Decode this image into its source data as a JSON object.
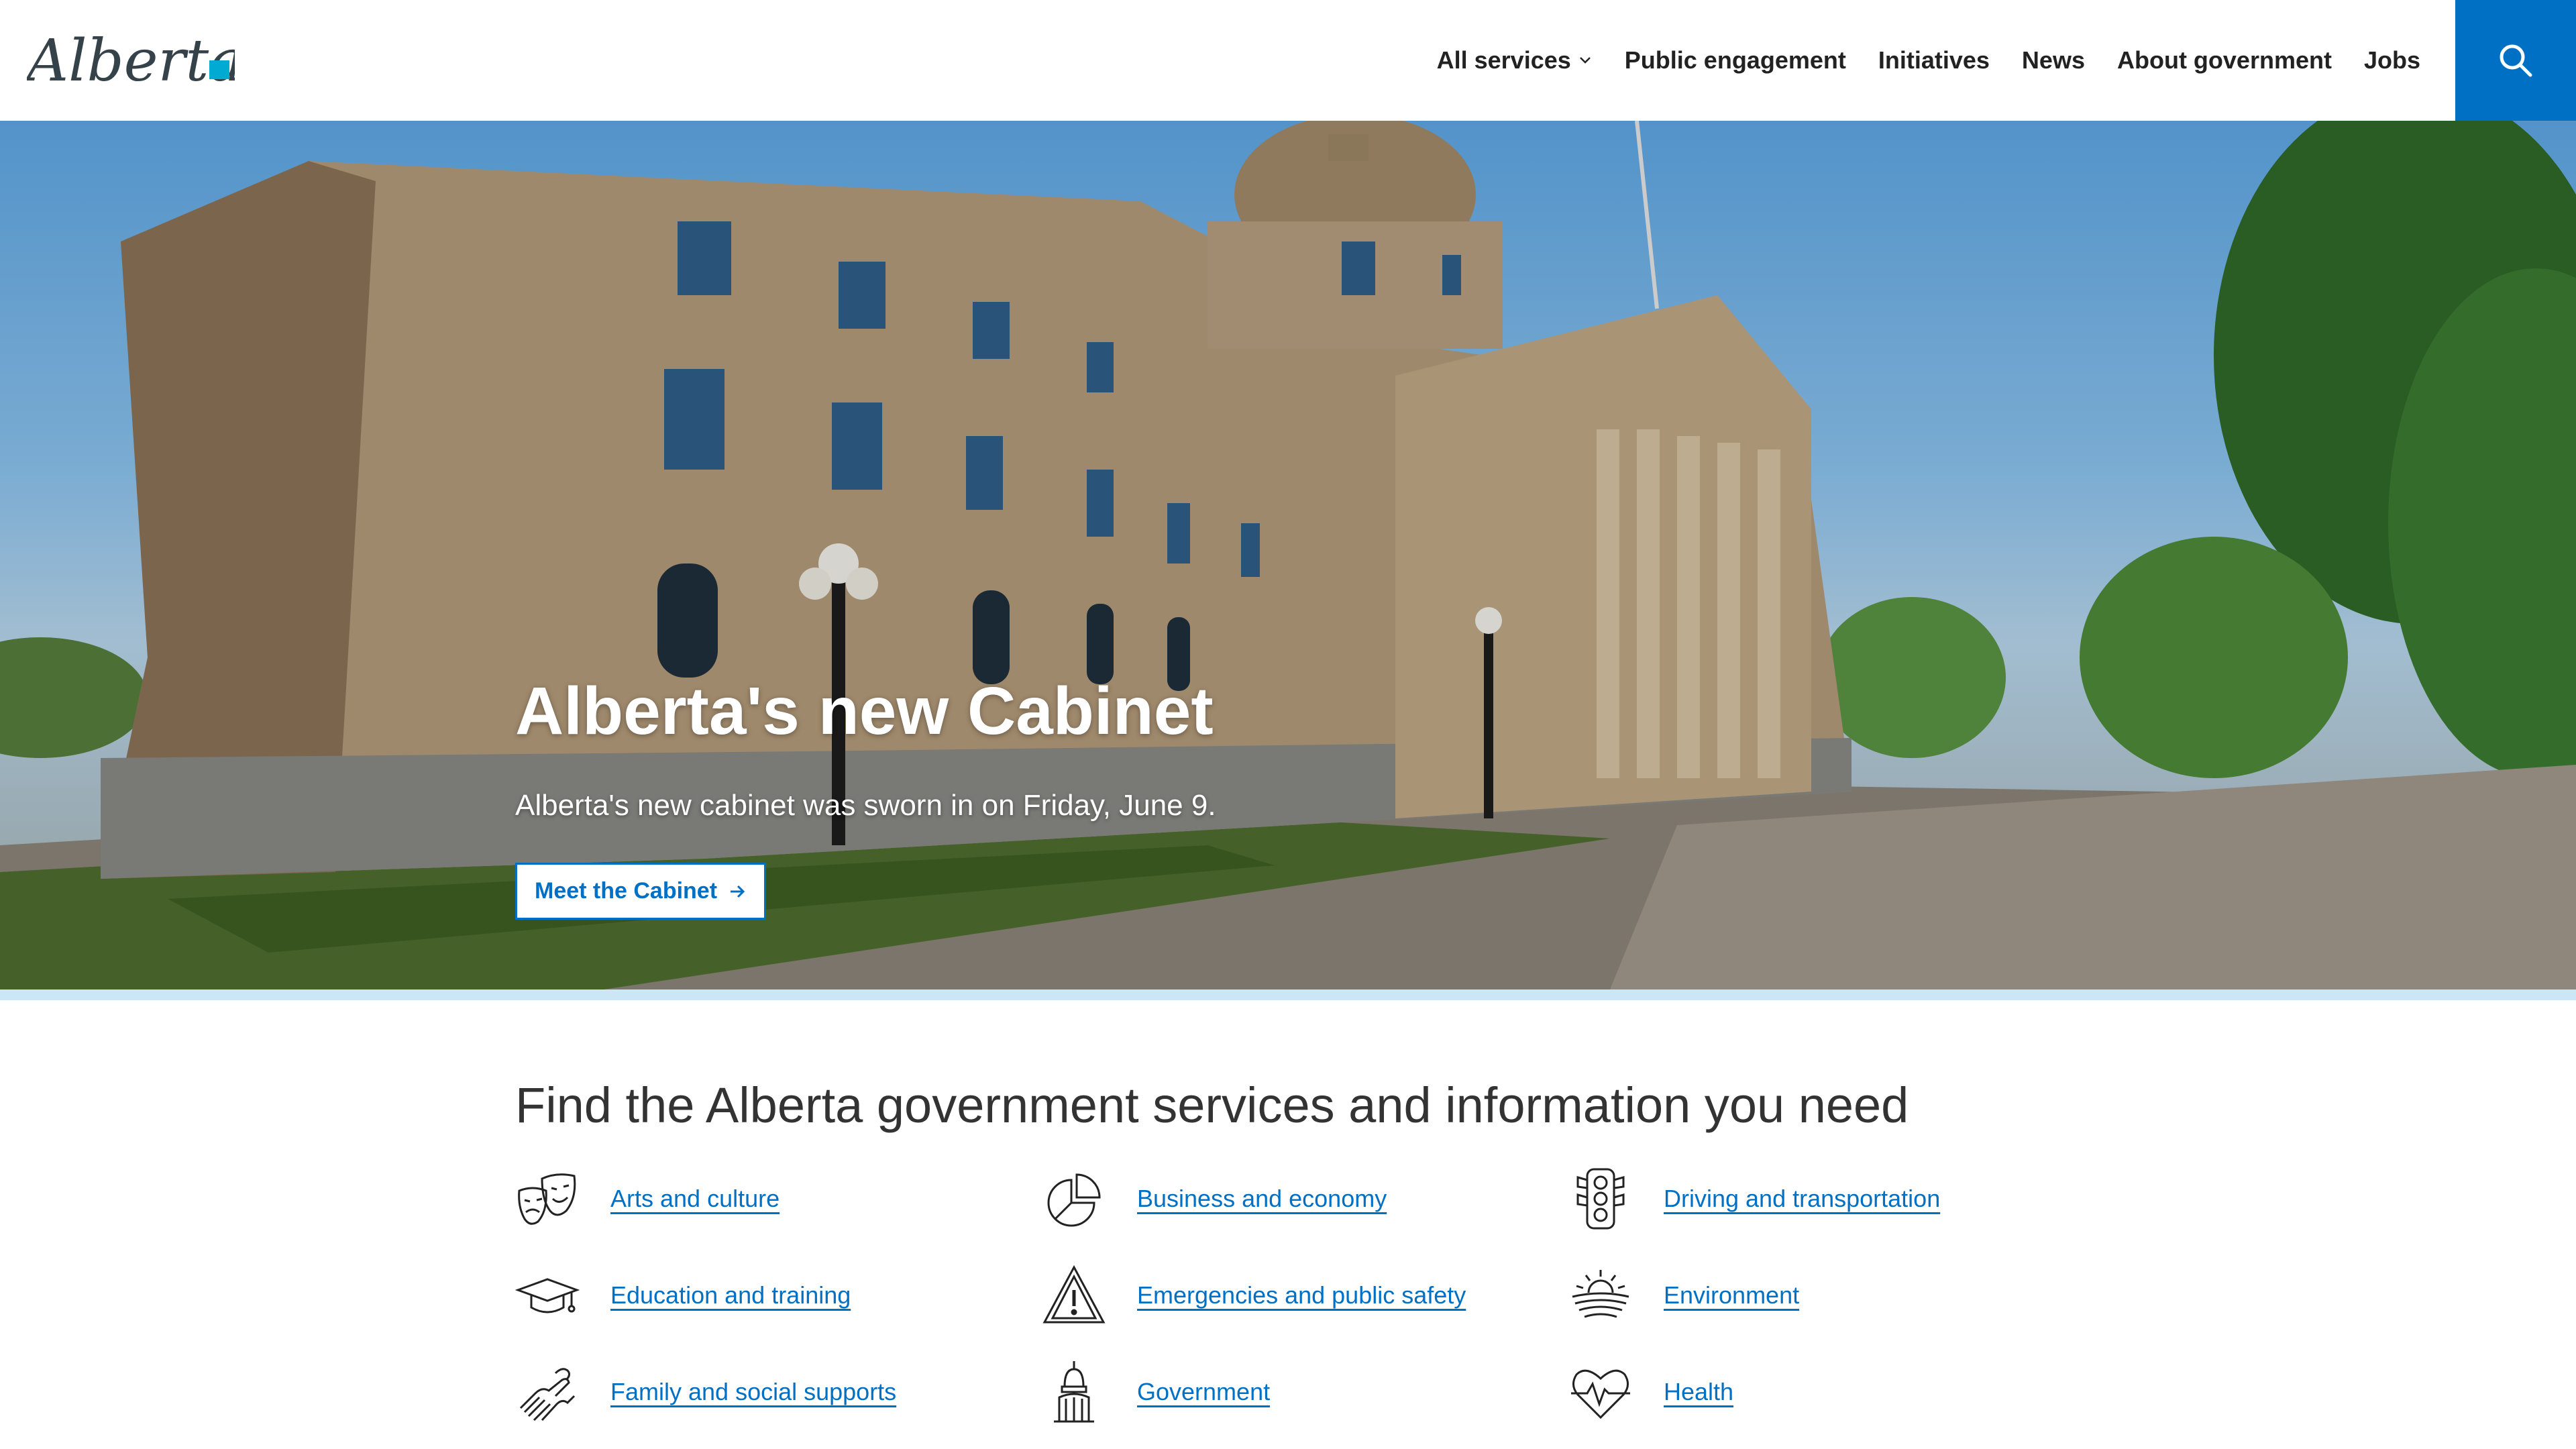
{
  "header": {
    "logo_text": "Alberta",
    "nav": [
      {
        "label": "All services",
        "has_dropdown": true
      },
      {
        "label": "Public engagement"
      },
      {
        "label": "Initiatives"
      },
      {
        "label": "News"
      },
      {
        "label": "About government"
      },
      {
        "label": "Jobs"
      }
    ],
    "search_icon": "search-icon"
  },
  "hero": {
    "title": "Alberta's new Cabinet",
    "subtitle": "Alberta's new cabinet was sworn in on Friday, June 9.",
    "button_label": "Meet the Cabinet",
    "button_icon": "arrow-right-icon"
  },
  "services": {
    "title": "Find the Alberta government services and information you need",
    "items": [
      {
        "label": "Arts and culture",
        "icon": "theatre-masks-icon"
      },
      {
        "label": "Business and economy",
        "icon": "pie-chart-icon"
      },
      {
        "label": "Driving and transportation",
        "icon": "traffic-light-icon"
      },
      {
        "label": "Education and training",
        "icon": "graduation-cap-icon"
      },
      {
        "label": "Emergencies and public safety",
        "icon": "warning-triangle-icon"
      },
      {
        "label": "Environment",
        "icon": "sun-horizon-icon"
      },
      {
        "label": "Family and social supports",
        "icon": "hands-icon"
      },
      {
        "label": "Government",
        "icon": "legislature-dome-icon"
      },
      {
        "label": "Health",
        "icon": "heart-pulse-icon"
      }
    ]
  },
  "colors": {
    "primary_blue": "#0070c4",
    "strip": "#cbe6f5",
    "text_dark": "#333333"
  }
}
